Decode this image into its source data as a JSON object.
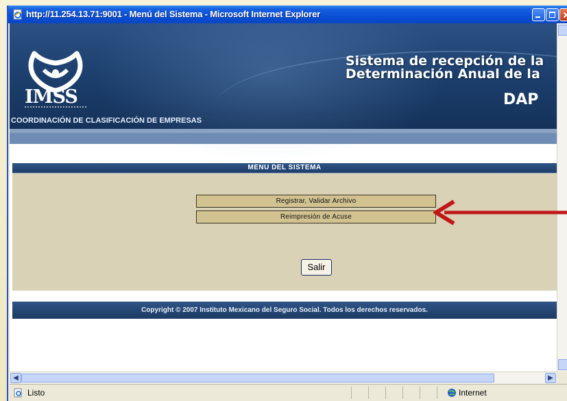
{
  "window": {
    "title": "http://11.254.13.71:9001 - Menú del Sistema - Microsoft Internet Explorer"
  },
  "banner": {
    "logo_text": "IMSS",
    "system_title_line1": "Sistema de recepción de la",
    "system_title_line2": "Determinación Anual de la",
    "system_short": "DAP",
    "coordination": "COORDINACIÓN DE CLASIFICACIÓN DE EMPRESAS"
  },
  "menu": {
    "header": "MENU DEL SISTEMA",
    "items": [
      {
        "label": "Registrar, Validar Archivo"
      },
      {
        "label": "Reimpresión de Acuse"
      }
    ],
    "exit_label": "Salir"
  },
  "footer": {
    "copyright": "Copyright © 2007 Instituto Mexicano del Seguro Social. Todos los derechos reservados."
  },
  "statusbar": {
    "status": "Listo",
    "zone": "Internet"
  },
  "colors": {
    "banner": "#1c3f6d",
    "menu_body": "#d9d2b7",
    "menu_button": "#d1c290",
    "arrow": "#c0181a"
  }
}
